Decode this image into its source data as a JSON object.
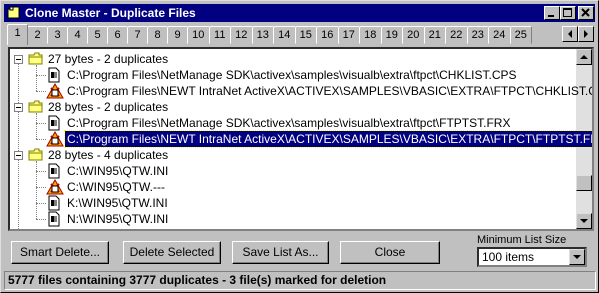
{
  "window": {
    "title": "Clone Master - Duplicate Files",
    "title_bar_colors": {
      "active": "#000080",
      "text": "#ffffff"
    },
    "controls": [
      "minimize-icon",
      "maximize-icon",
      "close-icon"
    ]
  },
  "tabs": {
    "items": [
      "1",
      "2",
      "3",
      "4",
      "5",
      "6",
      "7",
      "8",
      "9",
      "10",
      "11",
      "12",
      "13",
      "14",
      "15",
      "16",
      "17",
      "18",
      "19",
      "20",
      "21",
      "22",
      "23",
      "24",
      "25"
    ],
    "selected": "1",
    "scroll_icons": [
      "arrow-left-icon",
      "arrow-right-icon"
    ]
  },
  "tree": {
    "groups": [
      {
        "label": "27 bytes - 2 duplicates",
        "files": [
          {
            "path": "C:\\Program Files\\NetManage SDK\\activex\\samples\\visualb\\extra\\ftpct\\CHKLIST.CPS",
            "marked": false
          },
          {
            "path": "C:\\Program Files\\NEWT IntraNet ActiveX\\ACTIVEX\\SAMPLES\\VBASIC\\EXTRA\\FTPCT\\CHKLIST.CPS",
            "marked": true
          }
        ]
      },
      {
        "label": "28 bytes - 2 duplicates",
        "files": [
          {
            "path": "C:\\Program Files\\NetManage SDK\\activex\\samples\\visualb\\extra\\ftpct\\FTPTST.FRX",
            "marked": false
          },
          {
            "path": "C:\\Program Files\\NEWT IntraNet ActiveX\\ACTIVEX\\SAMPLES\\VBASIC\\EXTRA\\FTPCT\\FTPTST.FRX",
            "marked": true,
            "selected": true
          }
        ]
      },
      {
        "label": "28 bytes - 4 duplicates",
        "files": [
          {
            "path": "C:\\WIN95\\QTW.INI",
            "marked": false
          },
          {
            "path": "C:\\WIN95\\QTW.---",
            "marked": true
          },
          {
            "path": "K:\\WIN95\\QTW.INI",
            "marked": false
          },
          {
            "path": "N:\\WIN95\\QTW.INI",
            "marked": false
          }
        ]
      }
    ]
  },
  "buttons": {
    "smart_delete": "Smart Delete...",
    "delete_selected": "Delete Selected",
    "save_list_as": "Save List As...",
    "close": "Close"
  },
  "min_list_size": {
    "label": "Minimum List Size",
    "value": "100 items"
  },
  "status_text": "5777 files containing 3777 duplicates - 3 file(s) marked for deletion"
}
